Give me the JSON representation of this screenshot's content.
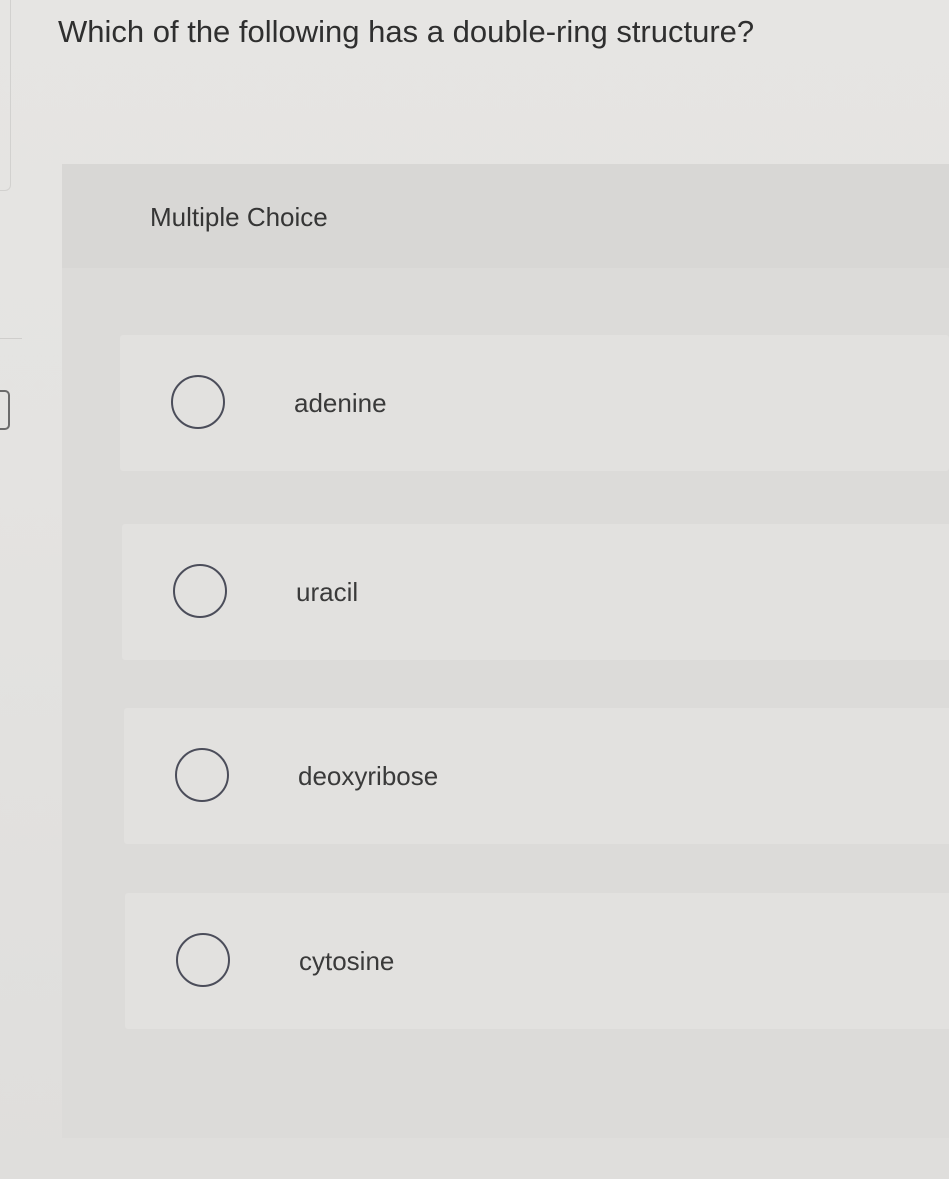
{
  "question": {
    "text": "Which of the following has a double-ring structure?"
  },
  "multiple_choice": {
    "header_label": "Multiple Choice",
    "options": [
      {
        "label": "adenine"
      },
      {
        "label": "uracil"
      },
      {
        "label": "deoxyribose"
      },
      {
        "label": "cytosine"
      }
    ]
  }
}
